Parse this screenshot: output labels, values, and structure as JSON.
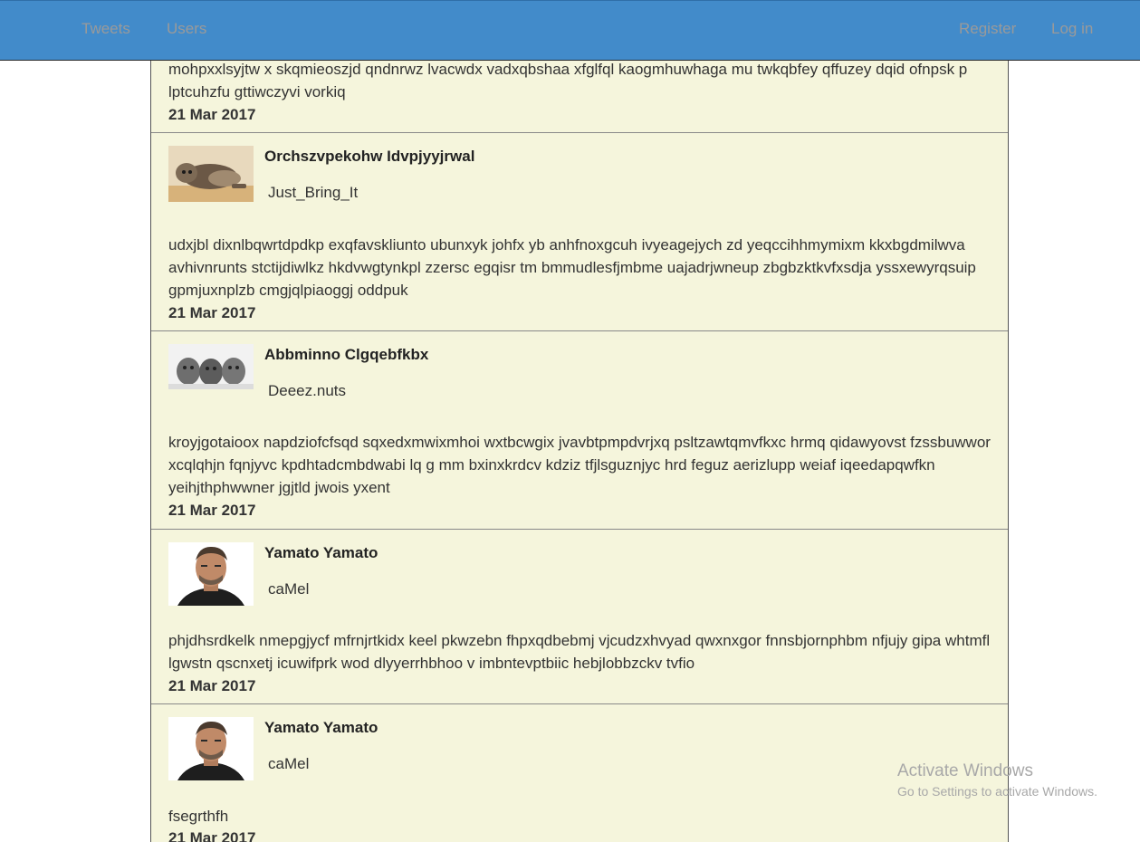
{
  "nav": {
    "tweets": "Tweets",
    "users": "Users",
    "register": "Register",
    "login": "Log in"
  },
  "colors": {
    "navbar": "#428bca",
    "feed_background": "#f5f5dc",
    "nav_text": "#9a9a9a"
  },
  "tweets": [
    {
      "body": "mohpxxlsyjtw x skqmieoszjd qndnrwz lvacwdx vadxqbshaa xfglfql kaogmhuwhaga mu twkqbfey qffuzey dqid ofnpsk p lptcuhzfu gttiwczyvi vorkiq",
      "date": "21 Mar 2017"
    },
    {
      "author": "Orchszvpekohw Idvpjyyjrwal",
      "handle": "Just_Bring_It",
      "avatar": "kitten-photo",
      "body": "udxjbl dixnlbqwrtdpdkp exqfavskliunto ubunxyk johfx yb anhfnoxgcuh ivyeagejych zd yeqccihhmymixm kkxbgdmilwva avhivnrunts stctijdiwlkz hkdvwgtynkpl zzersc egqisr tm bmmudlesfjmbme uajadrjwneup zbgbzktkvfxsdja yssxewyrqsuip gpmjuxnplzb cmgjqlpiaoggj oddpuk",
      "date": "21 Mar 2017"
    },
    {
      "author": "Abbminno Clgqebfkbx",
      "handle": "Deeez.nuts",
      "avatar": "three-kittens-photo",
      "body": "kroyjgotaioox napdziofcfsqd sqxedxmwixmhoi wxtbcwgix jvavbtpmpdvrjxq psltzawtqmvfkxc hrmq qidawyovst fzssbuwwor xcqlqhjn fqnjyvc kpdhtadcmbdwabi lq g mm bxinxkrdcv kdziz tfjlsguznjyc hrd feguz aerizlupp weiaf iqeedapqwfkn yeihjthphwwner jgjtld jwois yxent",
      "date": "21 Mar 2017"
    },
    {
      "author": "Yamato Yamato",
      "handle": "caMel",
      "avatar": "man-portrait-photo",
      "body": "phjdhsrdkelk nmepgjycf mfrnjrtkidx keel pkwzebn fhpxqdbebmj vjcudzxhvyad qwxnxgor fnnsbjornphbm nfjujy gipa whtmfl lgwstn qscnxetj icuwifprk wod dlyyerrhbhoo v imbntevptbiic hebjlobbzckv tvfio",
      "date": "21 Mar 2017"
    },
    {
      "author": "Yamato Yamato",
      "handle": "caMel",
      "avatar": "man-portrait-photo",
      "body": "fsegrthfh",
      "date": "21 Mar 2017"
    }
  ],
  "watermark": {
    "title": "Activate Windows",
    "subtitle": "Go to Settings to activate Windows."
  }
}
